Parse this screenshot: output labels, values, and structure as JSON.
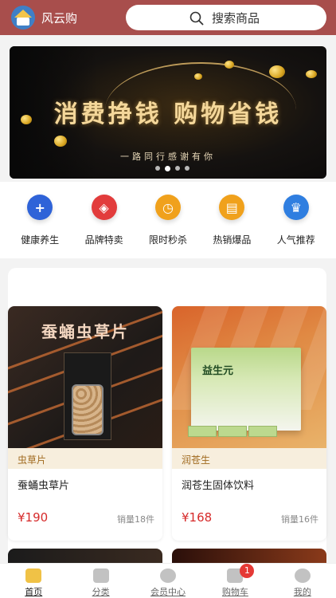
{
  "header": {
    "app_name": "风云购",
    "search_placeholder": "搜索商品",
    "accent_color": "#a84e4c"
  },
  "banner": {
    "headline": "消费挣钱 购物省钱",
    "subline": "一路同行感谢有你",
    "slide_count": 4,
    "active_slide": 2
  },
  "categories": [
    {
      "label": "健康养生",
      "icon": "health-plus-icon",
      "color": "#2f63d8"
    },
    {
      "label": "品牌特卖",
      "icon": "brand-tag-icon",
      "color": "#e23c3c"
    },
    {
      "label": "限时秒杀",
      "icon": "clock-icon",
      "color": "#f0a11c"
    },
    {
      "label": "热销爆品",
      "icon": "hot-sale-icon",
      "color": "#f0a11c"
    },
    {
      "label": "人气推荐",
      "icon": "popular-icon",
      "color": "#2f7ee0"
    }
  ],
  "products": [
    {
      "image_title": "蚕蛹虫草片",
      "tag": "虫草片",
      "name": "蚕蛹虫草片",
      "price": "¥190",
      "sales": "销量18件"
    },
    {
      "image_title": "益生元",
      "tag": "润苍生",
      "name": "润苍生固体饮料",
      "price": "¥168",
      "sales": "销量16件"
    }
  ],
  "tabbar": [
    {
      "label": "首页",
      "icon": "home-icon",
      "active": true
    },
    {
      "label": "分类",
      "icon": "category-icon",
      "active": false
    },
    {
      "label": "会员中心",
      "icon": "member-icon",
      "active": false
    },
    {
      "label": "购物车",
      "icon": "cart-icon",
      "active": false,
      "badge": "1"
    },
    {
      "label": "我的",
      "icon": "profile-icon",
      "active": false
    }
  ]
}
